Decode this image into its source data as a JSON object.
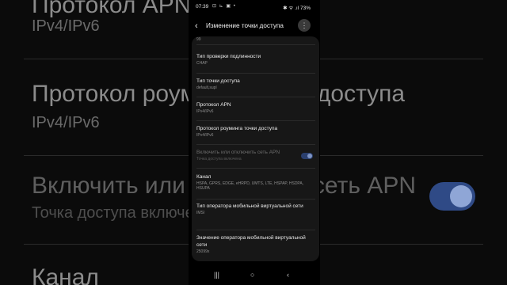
{
  "background": {
    "rows": [
      {
        "text": "Протокол APN",
        "kind": "big"
      },
      {
        "text": "IPv4/IPv6",
        "kind": "small"
      },
      {
        "text": "Протокол роуминга точки доступа",
        "kind": "big"
      },
      {
        "text": "IPv4/IPv6",
        "kind": "small"
      },
      {
        "text": "Включить или отключить сеть APN",
        "kind": "big"
      },
      {
        "text": "Точка доступа включена",
        "kind": "small"
      },
      {
        "text": "Канал",
        "kind": "big"
      }
    ]
  },
  "status": {
    "time": "07:39",
    "notif_icons": "⊡ ⊾ ▣ •",
    "right": "✱ ᯤ .ıl 73%"
  },
  "header": {
    "back": "‹",
    "title": "Изменение точки доступа",
    "more": "⋮"
  },
  "card": {
    "partial_value": "99",
    "items": [
      {
        "label": "Тип проверки подлинности",
        "value": "CHAP",
        "enabled": true
      },
      {
        "label": "Тип точки доступа",
        "value": "default,supl",
        "enabled": true
      },
      {
        "label": "Протокол APN",
        "value": "IPv4/IPv6",
        "enabled": true
      },
      {
        "label": "Протокол роуминга точки доступа",
        "value": "IPv4/IPv6",
        "enabled": true
      },
      {
        "label": "Включить или отключить сеть APN",
        "value": "Точка доступа включена",
        "enabled": false,
        "toggle": true,
        "toggle_on": true
      },
      {
        "label": "Канал",
        "value": "HSPA, GPRS, EDGE, eHRPD, UMTS, LTE, HSPAP, HSDPA, HSUPA",
        "enabled": true
      },
      {
        "label": "Тип оператора мобильной виртуальной сети",
        "value": "IMSI",
        "enabled": true
      },
      {
        "label": "Значение оператора мобильной виртуальной сети",
        "value": "25099x",
        "enabled": true
      }
    ]
  },
  "navbar": {
    "recents": "|||",
    "home": "○",
    "back": "‹"
  },
  "colors": {
    "accent": "#2f4a86",
    "card_bg": "#171717",
    "background": "#000000"
  }
}
